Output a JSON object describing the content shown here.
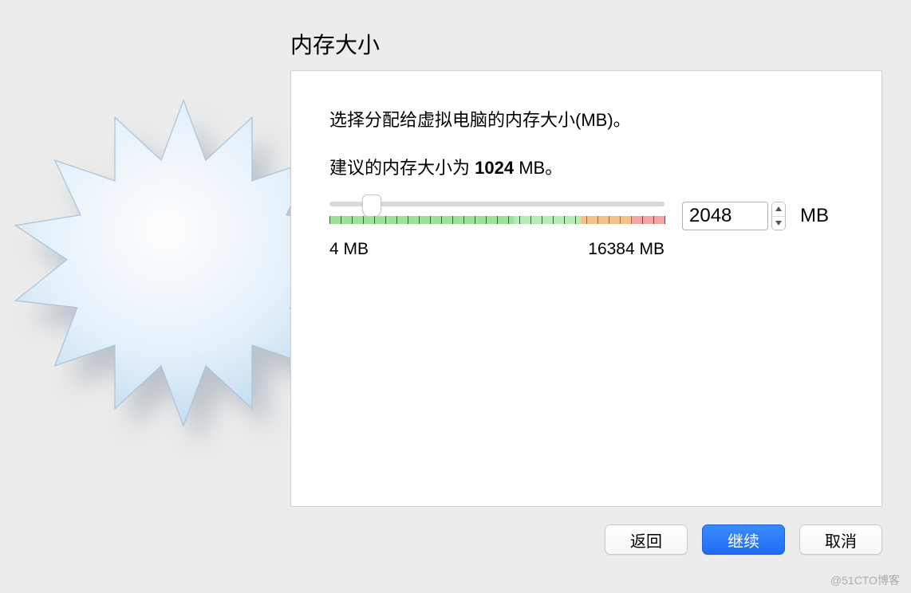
{
  "title": "内存大小",
  "panel": {
    "desc_prefix": "选择分配给虚拟电脑的内存大小(MB)。",
    "recommend_prefix": "建议的内存大小为 ",
    "recommend_value": "1024",
    "recommend_suffix": " MB。"
  },
  "slider": {
    "min_label": "4 MB",
    "max_label": "16384 MB",
    "min_value": 4,
    "max_value": 16384,
    "current_value": 2048,
    "thumb_percent": 12.5,
    "zones": {
      "green_pct": 55,
      "lightgreen_pct": 20,
      "orange_pct": 15,
      "red_pct": 10
    }
  },
  "spinner": {
    "value": "2048",
    "unit": "MB"
  },
  "buttons": {
    "back": "返回",
    "continue": "继续",
    "cancel": "取消"
  },
  "watermark": "@51CTO博客"
}
